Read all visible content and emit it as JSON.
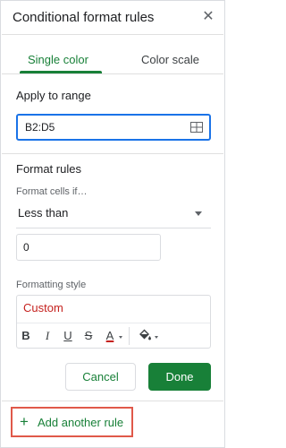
{
  "panel": {
    "title": "Conditional format rules",
    "close_glyph": "✕"
  },
  "tabs": {
    "single_color": "Single color",
    "color_scale": "Color scale",
    "active": "Single color"
  },
  "range": {
    "label": "Apply to range",
    "value": "B2:D5",
    "icon": "grid-select-icon"
  },
  "format_rules": {
    "label": "Format rules",
    "condition_label": "Format cells if…",
    "condition_value": "Less than",
    "value": "0"
  },
  "formatting_style": {
    "label": "Formatting style",
    "preview": "Custom",
    "preview_color": "#c5221f",
    "buttons": {
      "bold": "B",
      "italic": "I",
      "underline": "U",
      "strikethrough": "S",
      "text_color": "A"
    }
  },
  "actions": {
    "cancel": "Cancel",
    "done": "Done"
  },
  "add_rule": {
    "plus": "+",
    "label": "Add another rule"
  },
  "colors": {
    "accent": "#188038",
    "focus": "#1a73e8",
    "highlight_box": "#e0594a"
  }
}
